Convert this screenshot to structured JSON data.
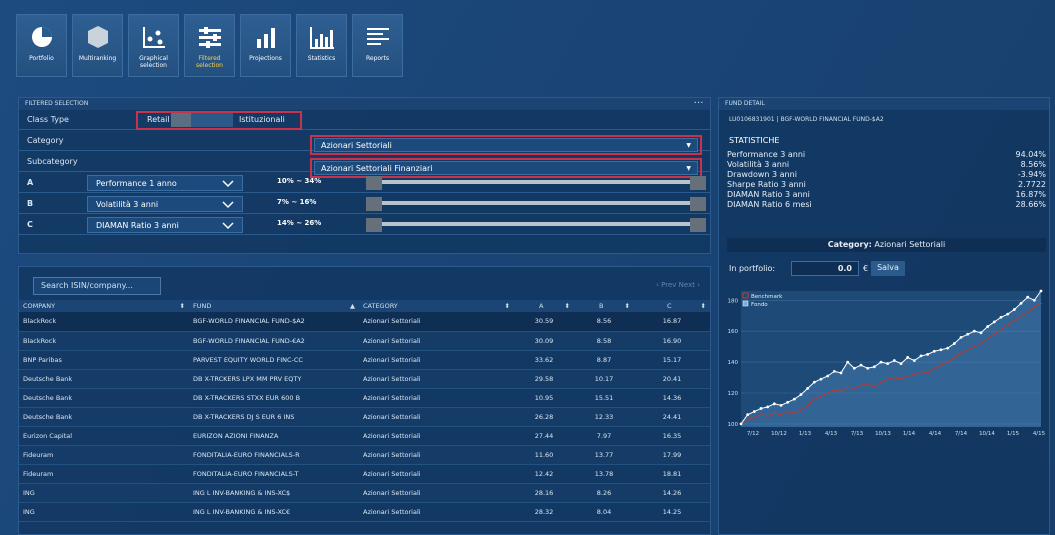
{
  "toolbar": {
    "items": [
      {
        "label": "Portfolio",
        "icon": "pie-chart-icon",
        "active": false
      },
      {
        "label": "Multiranking",
        "icon": "hexagon-icon",
        "active": false
      },
      {
        "label": "Graphical selection",
        "icon": "scatter-icon",
        "active": false
      },
      {
        "label": "Filtered selection",
        "icon": "sliders-icon",
        "active": true
      },
      {
        "label": "Projections",
        "icon": "bar-chart-icon",
        "active": false
      },
      {
        "label": "Statistics",
        "icon": "histogram-icon",
        "active": false
      },
      {
        "label": "Reports",
        "icon": "list-icon",
        "active": false
      }
    ]
  },
  "filter": {
    "title": "FILTERED SELECTION",
    "menu": "...",
    "class_type_label": "Class Type",
    "retail_label": "Retail",
    "institutional_label": "Istituzionali",
    "category_label": "Category",
    "category_value": "Azionari Settoriali",
    "subcategory_label": "Subcategory",
    "subcategory_value": "Azionari Settoriali Finanziari",
    "rows": [
      {
        "key": "A",
        "metric": "Performance 1 anno",
        "range": "10% ~ 34%"
      },
      {
        "key": "B",
        "metric": "Volatilità 3 anni",
        "range": "7% ~ 16%"
      },
      {
        "key": "C",
        "metric": "DIAMAN Ratio 3 anni",
        "range": "14% ~ 26%"
      }
    ]
  },
  "list": {
    "search_placeholder": "Search ISIN/company...",
    "pager": "‹ Prev   Next ›",
    "headers": {
      "company": "COMPANY",
      "fund": "FUND",
      "category": "CATEGORY",
      "a": "A",
      "b": "B",
      "c": "C"
    },
    "rows": [
      {
        "company": "BlackRock",
        "fund": "BGF-WORLD FINANCIAL FUND-$A2",
        "category": "Azionari Settoriali",
        "a": "30.59",
        "b": "8.56",
        "c": "16.87"
      },
      {
        "company": "BlackRock",
        "fund": "BGF-WORLD FINANCIAL FUND-€A2",
        "category": "Azionari Settoriali",
        "a": "30.09",
        "b": "8.58",
        "c": "16.90"
      },
      {
        "company": "BNP Paribas",
        "fund": "PARVEST EQUITY WORLD FINC-CC",
        "category": "Azionari Settoriali",
        "a": "33.62",
        "b": "8.87",
        "c": "15.17"
      },
      {
        "company": "Deutsche Bank",
        "fund": "DB X-TRCKERS LPX MM PRV EQTY",
        "category": "Azionari Settoriali",
        "a": "29.58",
        "b": "10.17",
        "c": "20.41"
      },
      {
        "company": "Deutsche Bank",
        "fund": "DB X-TRACKERS STXX EUR 600 B",
        "category": "Azionari Settoriali",
        "a": "10.95",
        "b": "15.51",
        "c": "14.36"
      },
      {
        "company": "Deutsche Bank",
        "fund": "DB X-TRACKERS DJ S EUR 6 INS",
        "category": "Azionari Settoriali",
        "a": "26.28",
        "b": "12.33",
        "c": "24.41"
      },
      {
        "company": "Eurizon Capital",
        "fund": "EURIZON AZIONI FINANZA",
        "category": "Azionari Settoriali",
        "a": "27.44",
        "b": "7.97",
        "c": "16.35"
      },
      {
        "company": "Fideuram",
        "fund": "FONDITALIA-EURO FINANCIALS-R",
        "category": "Azionari Settoriali",
        "a": "11.60",
        "b": "13.77",
        "c": "17.99"
      },
      {
        "company": "Fideuram",
        "fund": "FONDITALIA-EURO FINANCIALS-T",
        "category": "Azionari Settoriali",
        "a": "12.42",
        "b": "13.78",
        "c": "18.81"
      },
      {
        "company": "ING",
        "fund": "ING L INV-BANKING & INS-XC$",
        "category": "Azionari Settoriali",
        "a": "28.16",
        "b": "8.26",
        "c": "14.26"
      },
      {
        "company": "ING",
        "fund": "ING L INV-BANKING & INS-XC€",
        "category": "Azionari Settoriali",
        "a": "28.32",
        "b": "8.04",
        "c": "14.25"
      }
    ]
  },
  "detail": {
    "title": "FUND DETAIL",
    "subtitle": "LU0106831901 | BGF-WORLD FINANCIAL FUND-$A2",
    "stats_title": "STATISTICHE",
    "stats": [
      {
        "label": "Performance 3 anni",
        "value": "94.04%"
      },
      {
        "label": "Volatilità 3 anni",
        "value": "8.56%"
      },
      {
        "label": "Drawdown 3 anni",
        "value": "-3.94%"
      },
      {
        "label": "Sharpe Ratio 3 anni",
        "value": "2.7722"
      },
      {
        "label": "DIAMAN Ratio 3 anni",
        "value": "16.87%"
      },
      {
        "label": "DIAMAN Ratio 6 mesi",
        "value": "28.66%"
      }
    ],
    "category_prefix": "Category:",
    "category_value": "Azionari Settoriali",
    "portfolio_label": "In portfolio:",
    "portfolio_value": "0.0",
    "currency": "€",
    "save_label": "Salva"
  },
  "chart_data": {
    "type": "line",
    "legend": [
      "Benchmark",
      "Fondo"
    ],
    "legend_position": "top-left",
    "x_ticks": [
      "7/12",
      "10/12",
      "1/13",
      "4/13",
      "7/13",
      "10/13",
      "1/14",
      "4/14",
      "7/14",
      "10/14",
      "1/15",
      "4/15"
    ],
    "y_ticks": [
      100,
      120,
      140,
      160,
      180
    ],
    "ylim": [
      98,
      186
    ],
    "series": [
      {
        "name": "Benchmark",
        "color": "#c0392b",
        "values": [
          100,
          103,
          104,
          106,
          105,
          107,
          106,
          108,
          107,
          109,
          112,
          116,
          118,
          120,
          122,
          121,
          124,
          123,
          125,
          126,
          124,
          127,
          129,
          130,
          129,
          131,
          132,
          134,
          133,
          136,
          138,
          140,
          143,
          146,
          148,
          150,
          152,
          155,
          158,
          161,
          164,
          167,
          170,
          172,
          176,
          178
        ]
      },
      {
        "name": "Fondo",
        "color": "#ffffff",
        "values": [
          100,
          106,
          108,
          110,
          111,
          113,
          112,
          114,
          116,
          119,
          123,
          127,
          129,
          131,
          134,
          133,
          140,
          136,
          138,
          136,
          137,
          140,
          139,
          141,
          139,
          143,
          141,
          144,
          145,
          147,
          148,
          149,
          152,
          156,
          158,
          160,
          159,
          163,
          166,
          169,
          171,
          174,
          178,
          182,
          180,
          186
        ]
      }
    ]
  }
}
